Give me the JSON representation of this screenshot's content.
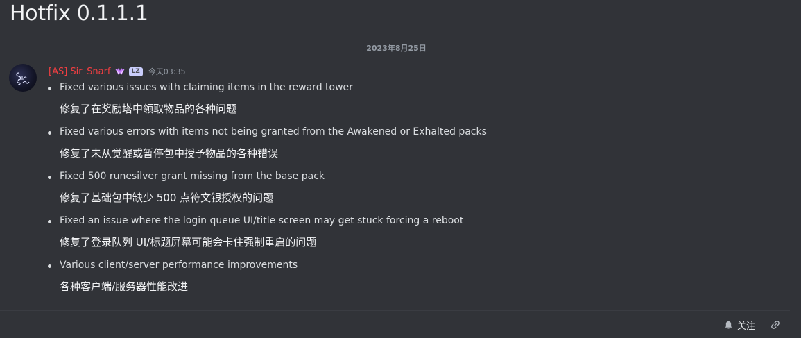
{
  "post": {
    "title": "Hotfix 0.1.1.1"
  },
  "divider": {
    "date": "2023年8月25日"
  },
  "message": {
    "username": "[AS] Sir_Snarf",
    "role_tag": "LZ",
    "timestamp": "今天03:35",
    "avatar_icon": "avatar-signature",
    "items": [
      {
        "en": "Fixed various issues with claiming items in the reward tower",
        "zh": "修复了在奖励塔中领取物品的各种问题"
      },
      {
        "en": "Fixed various errors with items not being granted from the Awakened or Exhalted packs",
        "zh": "修复了未从觉醒或暂停包中授予物品的各种错误"
      },
      {
        "en": "Fixed 500 runesilver grant missing from the base pack",
        "zh": "修复了基础包中缺少 500 点符文银授权的问题"
      },
      {
        "en": "Fixed an issue where the login queue UI/title screen may get stuck forcing a reboot",
        "zh": "修复了登录队列 UI/标题屏幕可能会卡住强制重启的问题"
      },
      {
        "en": "Various client/server performance improvements",
        "zh": "各种客户端/服务器性能改进"
      }
    ]
  },
  "footer": {
    "follow_label": "关注",
    "follow_icon": "bell-icon",
    "link_icon": "link-icon"
  },
  "colors": {
    "background": "#313338",
    "username": "#f23f42",
    "role_tag_bg": "#c9cdfb",
    "muted_text": "#949ba4"
  }
}
